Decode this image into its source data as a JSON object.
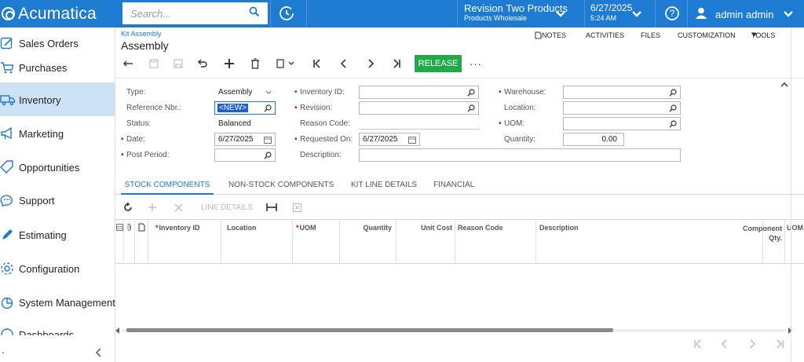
{
  "app": {
    "name": "Acumatica"
  },
  "search": {
    "placeholder": "Search..."
  },
  "branch": {
    "line1": "Revision Two Products",
    "line2": "Products Wholesale"
  },
  "date": {
    "line1": "6/27/2025",
    "line2": "5:24 AM"
  },
  "user": {
    "name": "admin admin"
  },
  "sidebar": {
    "items": [
      {
        "label": "Sales Orders",
        "icon": "pencil-square-icon"
      },
      {
        "label": "Purchases",
        "icon": "cart-icon"
      },
      {
        "label": "Inventory",
        "icon": "truck-icon",
        "active": true
      },
      {
        "label": "Marketing",
        "icon": "megaphone-icon"
      },
      {
        "label": "Opportunities",
        "icon": "tag-icon"
      },
      {
        "label": "Support",
        "icon": "chat-icon"
      },
      {
        "label": "Estimating",
        "icon": "pen-icon"
      },
      {
        "label": "Configuration",
        "icon": "gear-icon"
      },
      {
        "label": "System Management",
        "icon": "pie-icon"
      },
      {
        "label": "Dashboards",
        "icon": "dashboard-icon"
      }
    ]
  },
  "page": {
    "breadcrumb": "Kit Assembly",
    "title": "Assembly"
  },
  "toplinks": {
    "notes": "NOTES",
    "activities": "ACTIVITIES",
    "files": "FILES",
    "customization": "CUSTOMIZATION",
    "tools": "TOOLS"
  },
  "toolbar": {
    "release": "RELEASE",
    "more": "···"
  },
  "form": {
    "type_label": "Type:",
    "type_value": "Assembly",
    "refnbr_label": "Reference Nbr.:",
    "refnbr_value": "<NEW>",
    "status_label": "Status:",
    "status_value": "Balanced",
    "date_label": "Date:",
    "date_value": "6/27/2025",
    "postperiod_label": "Post Period:",
    "postperiod_value": "",
    "inventoryid_label": "Inventory ID:",
    "inventoryid_value": "",
    "revision_label": "Revision:",
    "revision_value": "",
    "reasoncode_label": "Reason Code:",
    "reasoncode_value": "",
    "requestedon_label": "Requested On:",
    "requestedon_value": "6/27/2025",
    "description_label": "Description:",
    "description_value": "",
    "warehouse_label": "Warehouse:",
    "warehouse_value": "",
    "location_label": "Location:",
    "location_value": "",
    "uom_label": "UOM:",
    "uom_value": "",
    "quantity_label": "Quantity:",
    "quantity_value": "0.00"
  },
  "tabs": [
    {
      "label": "STOCK COMPONENTS",
      "active": true
    },
    {
      "label": "NON-STOCK COMPONENTS"
    },
    {
      "label": "KIT LINE DETAILS"
    },
    {
      "label": "FINANCIAL"
    }
  ],
  "gridbar": {
    "line_details": "LINE DETAILS"
  },
  "grid": {
    "columns": [
      "Inventory ID",
      "Location",
      "UOM",
      "Quantity",
      "Unit Cost",
      "Reason Code",
      "Description",
      "Component Qty.",
      "UOM"
    ]
  },
  "colors": {
    "accent": "#1d7bd1",
    "release": "#23a84a",
    "active_nav": "#cde3f5",
    "required": "#d0021b"
  }
}
